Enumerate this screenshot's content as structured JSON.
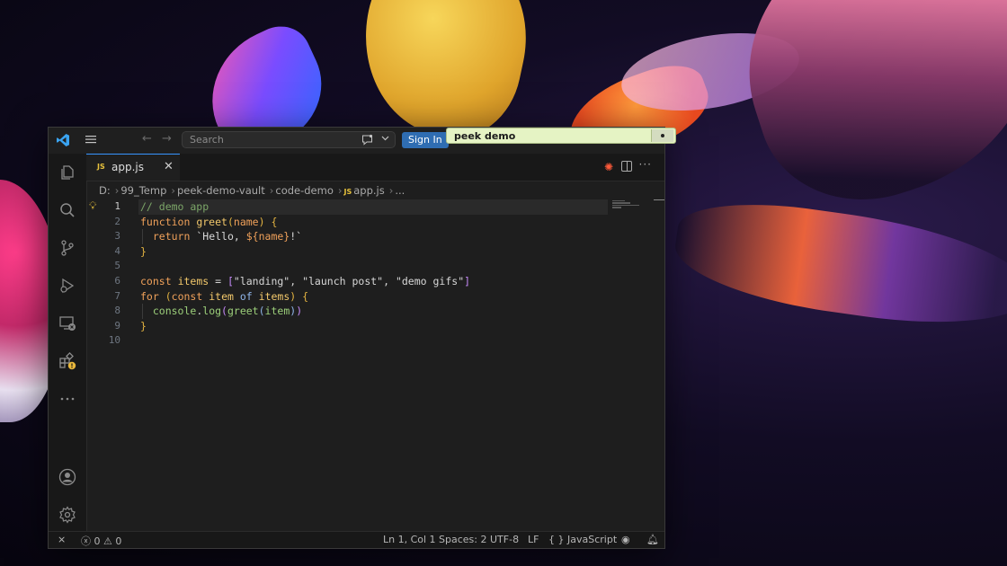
{
  "titlebar": {
    "search_placeholder": "Search",
    "signin_label": "Sign In"
  },
  "peek": {
    "title": "peek demo"
  },
  "tab": {
    "file_badge": "JS",
    "file_name": "app.js",
    "close_glyph": "✕"
  },
  "breadcrumb": {
    "drive": "D:",
    "folder1": "99_Temp",
    "folder2": "peek-demo-vault",
    "folder3": "code-demo",
    "badge": "JS",
    "file": "app.js",
    "more": "..."
  },
  "editor": {
    "line_numbers": [
      "1",
      "2",
      "3",
      "4",
      "5",
      "6",
      "7",
      "8",
      "9",
      "10"
    ],
    "l1": "// demo app",
    "l2_kw": "function",
    "l2_fn": "greet",
    "l2_param": "name",
    "l3_kw": "return",
    "l3_str_a": "`Hello, ",
    "l3_interp": "name",
    "l3_str_b": "!`",
    "l6_kw": "const",
    "l6_var": "items",
    "l6_s1": "\"landing\"",
    "l6_s2": "\"launch post\"",
    "l6_s3": "\"demo gifs\"",
    "l7_kw": "for",
    "l7_kw2": "const",
    "l7_var": "item",
    "l7_of": "of",
    "l7_var2": "items",
    "l8_obj": "console",
    "l8_fn": "log",
    "l8_fn2": "greet",
    "l8_arg": "item"
  },
  "statusbar": {
    "errors": "0",
    "warnings": "0",
    "position": "Ln 1, Col 1",
    "spaces": "Spaces: 2",
    "encoding": "UTF-8",
    "eol": "LF",
    "language_glyph": "{ }",
    "language": "JavaScript"
  },
  "colors": {
    "accent": "#3794ff",
    "signin": "#2f6db2",
    "peek_bg": "#e5f3c4"
  }
}
